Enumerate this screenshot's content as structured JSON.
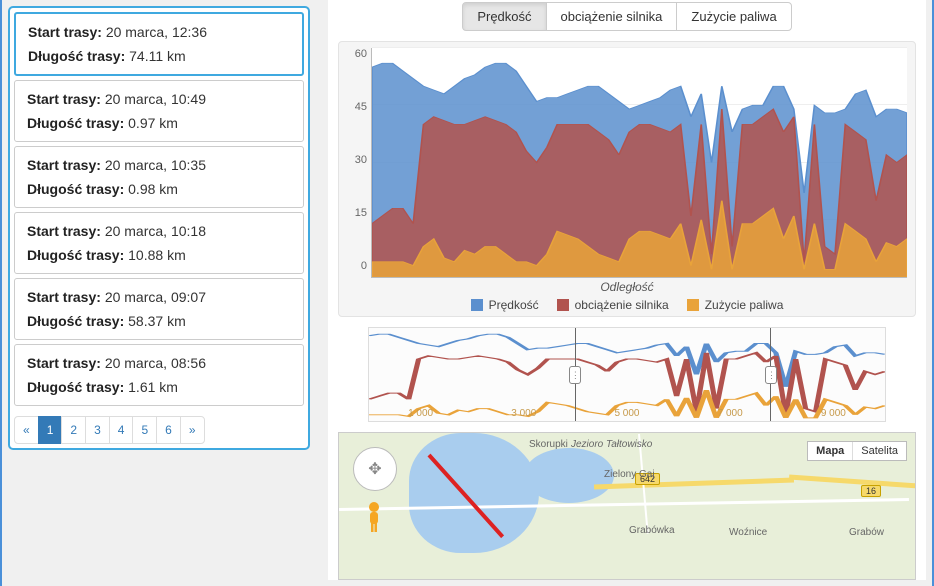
{
  "labels": {
    "start": "Start trasy:",
    "length": "Długość trasy:"
  },
  "routes": [
    {
      "start": "20 marca, 12:36",
      "length": "74.11 km",
      "active": true
    },
    {
      "start": "20 marca, 10:49",
      "length": "0.97 km",
      "active": false
    },
    {
      "start": "20 marca, 10:35",
      "length": "0.98 km",
      "active": false
    },
    {
      "start": "20 marca, 10:18",
      "length": "10.88 km",
      "active": false
    },
    {
      "start": "20 marca, 09:07",
      "length": "58.37 km",
      "active": false
    },
    {
      "start": "20 marca, 08:56",
      "length": "1.61 km",
      "active": false
    }
  ],
  "pagination": {
    "pages": [
      "«",
      "1",
      "2",
      "3",
      "4",
      "5",
      "6",
      "»"
    ],
    "active_index": 1
  },
  "tabs": {
    "items": [
      "Prędkość",
      "obciążenie silnika",
      "Zużycie paliwa"
    ],
    "active_index": 0
  },
  "legend": {
    "items": [
      "Prędkość",
      "obciążenie silnika",
      "Zużycie paliwa"
    ],
    "colors": [
      "#5b8fce",
      "#b1534e",
      "#e9a33a"
    ]
  },
  "chart_data": {
    "type": "area",
    "xlabel": "Odległość",
    "ylabel": "",
    "ylim": [
      0,
      60
    ],
    "y_ticks": [
      0,
      15,
      30,
      45,
      60
    ],
    "series": [
      {
        "name": "Prędkość",
        "color": "#5b8fce",
        "values": [
          55,
          56,
          56,
          54,
          52,
          50,
          49,
          48,
          50,
          52,
          53,
          55,
          56,
          56,
          54,
          50,
          46,
          47,
          47,
          48,
          49,
          50,
          50,
          48,
          46,
          44,
          45,
          46,
          47,
          49,
          50,
          42,
          48,
          30,
          50,
          38,
          44,
          45,
          45,
          50,
          50,
          44,
          22,
          45,
          43,
          43,
          44,
          48,
          49,
          42,
          44,
          44,
          43
        ]
      },
      {
        "name": "obciążenie silnika",
        "color": "#b1534e",
        "values": [
          14,
          16,
          18,
          18,
          14,
          40,
          42,
          41,
          40,
          40,
          41,
          42,
          41,
          40,
          38,
          33,
          30,
          34,
          40,
          40,
          40,
          40,
          38,
          36,
          32,
          38,
          40,
          40,
          39,
          38,
          40,
          16,
          40,
          6,
          44,
          8,
          40,
          40,
          42,
          44,
          38,
          42,
          4,
          40,
          8,
          6,
          40,
          38,
          36,
          20,
          32,
          30,
          32
        ]
      },
      {
        "name": "Zużycie paliwa",
        "color": "#e9a33a",
        "values": [
          4,
          4,
          4,
          4,
          3,
          8,
          10,
          5,
          4,
          7,
          6,
          8,
          8,
          6,
          4,
          4,
          3,
          6,
          12,
          11,
          10,
          8,
          6,
          5,
          4,
          10,
          12,
          12,
          11,
          10,
          14,
          3,
          15,
          2,
          20,
          2,
          14,
          14,
          16,
          18,
          10,
          16,
          2,
          14,
          2,
          2,
          14,
          12,
          10,
          4,
          9,
          8,
          10
        ]
      }
    ],
    "x_note": "values are sampled evenly across the visible x-range"
  },
  "mini_chart": {
    "ticks": [
      "1 000",
      "3 000",
      "5 000",
      "7 000",
      "9 000"
    ],
    "selection": {
      "from_pct": 40,
      "to_pct": 78
    }
  },
  "map": {
    "type_labels": [
      "Mapa",
      "Satelita"
    ],
    "type_active": 0,
    "towns": [
      "Skorupki",
      "Jezioro Tałtowisko",
      "Zielony Gaj",
      "Grabówka",
      "Woźnice",
      "Grabów"
    ],
    "road_labels": [
      "642",
      "16"
    ]
  }
}
